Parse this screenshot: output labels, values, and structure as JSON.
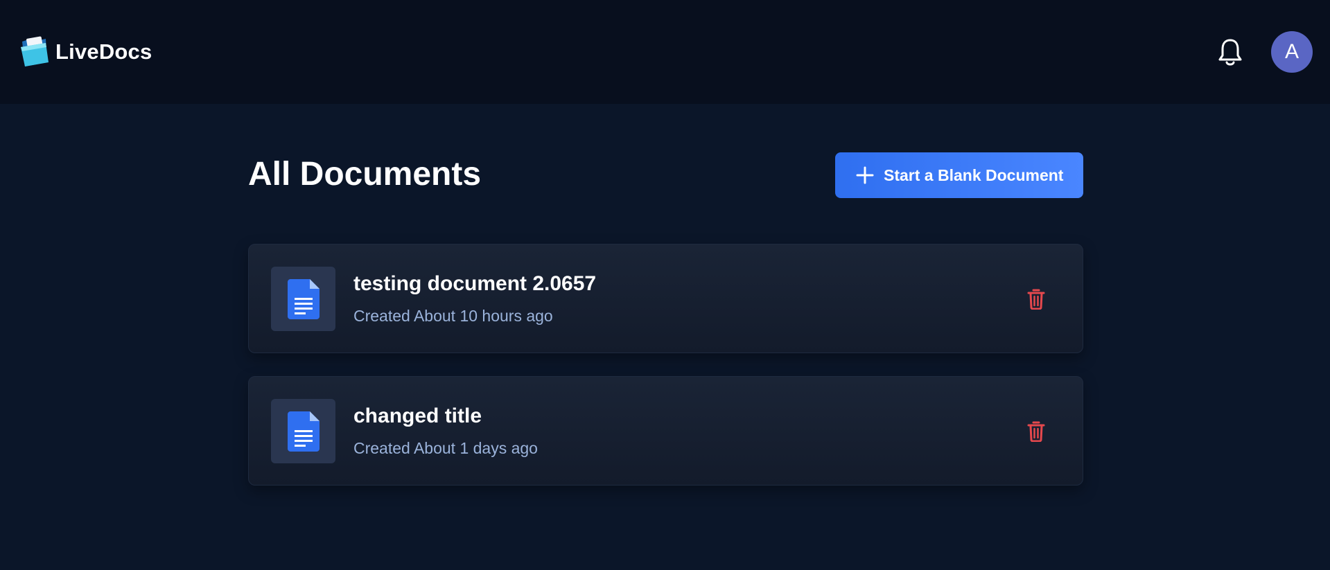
{
  "app": {
    "name": "LiveDocs",
    "logo_icon": "folder-logo-icon"
  },
  "header": {
    "notification_icon": "bell-icon",
    "avatar_initial": "A"
  },
  "main": {
    "title": "All Documents",
    "new_document_button": {
      "label": "Start a Blank Document",
      "icon": "plus-icon"
    },
    "documents": [
      {
        "title": "testing document 2.0657",
        "created": "Created About 10 hours ago"
      },
      {
        "title": "changed title",
        "created": "Created About 1 days ago"
      }
    ]
  },
  "colors": {
    "background": "#0b1629",
    "header_background": "#080f1e",
    "accent": "#3b7bff",
    "avatar": "#5a66c4",
    "delete": "#e5484d",
    "subtitle_text": "#9bb3db",
    "doc_icon": "#2f6ff0"
  }
}
